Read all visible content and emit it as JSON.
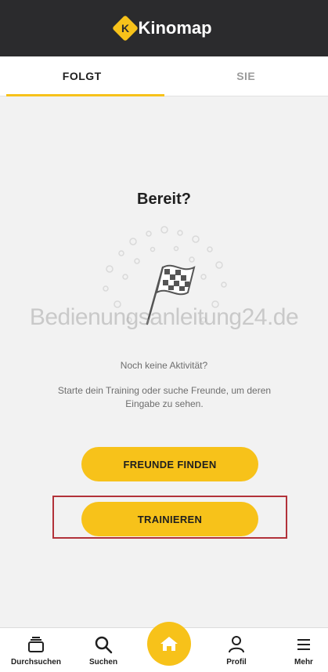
{
  "app": {
    "name": "Kinomap",
    "logo_mark": "K"
  },
  "tabs": [
    {
      "label": "FOLGT",
      "active": true
    },
    {
      "label": "SIE",
      "active": false
    }
  ],
  "main": {
    "title": "Bereit?",
    "watermark": "Bedienungsanleitung24.de",
    "empty_title": "Noch keine Aktivität?",
    "empty_description": "Starte dein Training oder suche Freunde, um deren Eingabe zu sehen.",
    "illustration_icon": "checkered-flag-icon",
    "buttons": {
      "find_friends": "FREUNDE FINDEN",
      "train": "TRAINIEREN"
    }
  },
  "bottom_nav": {
    "items": [
      {
        "label": "Durchsuchen",
        "icon": "browse-icon"
      },
      {
        "label": "Suchen",
        "icon": "search-icon"
      },
      {
        "label": "",
        "icon": "home-icon"
      },
      {
        "label": "Profil",
        "icon": "profile-icon"
      },
      {
        "label": "Mehr",
        "icon": "menu-icon"
      }
    ]
  },
  "colors": {
    "accent": "#f7c21a",
    "header": "#2b2b2d",
    "highlight": "#b2323a",
    "background": "#f2f2f2"
  }
}
